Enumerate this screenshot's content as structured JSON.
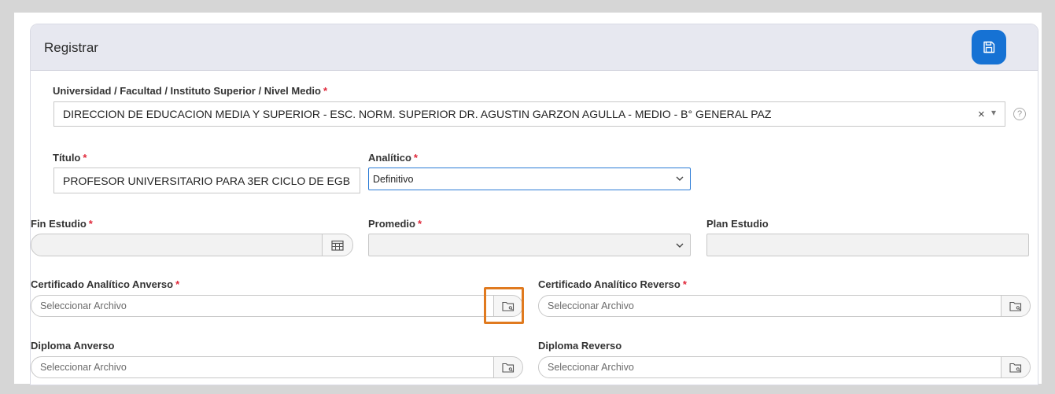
{
  "header": {
    "title": "Registrar",
    "save_icon": "save-icon"
  },
  "universidad": {
    "label": "Universidad / Facultad / Instituto Superior / Nivel Medio",
    "required": "*",
    "value": "DIRECCION DE EDUCACION MEDIA Y SUPERIOR - ESC. NORM. SUPERIOR DR. AGUSTIN GARZON AGULLA - MEDIO - B° GENERAL PAZ",
    "clear": "×",
    "arrow": "▾",
    "help": "?"
  },
  "titulo": {
    "label": "Título",
    "required": "*",
    "value": "PROFESOR UNIVERSITARIO PARA 3ER CICLO DE EGB"
  },
  "analitico": {
    "label": "Analítico",
    "required": "*",
    "value": "Definitivo"
  },
  "fin_estudio": {
    "label": "Fin Estudio",
    "required": "*",
    "value": ""
  },
  "promedio": {
    "label": "Promedio",
    "required": "*",
    "value": ""
  },
  "plan_estudio": {
    "label": "Plan Estudio",
    "value": ""
  },
  "cert_anverso": {
    "label": "Certificado Analítico Anverso",
    "required": "*",
    "placeholder": "Seleccionar Archivo"
  },
  "cert_reverso": {
    "label": "Certificado Analítico Reverso",
    "required": "*",
    "placeholder": "Seleccionar Archivo"
  },
  "diploma_anverso": {
    "label": "Diploma Anverso",
    "placeholder": "Seleccionar Archivo"
  },
  "diploma_reverso": {
    "label": "Diploma Reverso",
    "placeholder": "Seleccionar Archivo"
  },
  "colors": {
    "primary": "#1672d4",
    "required": "#e0283a",
    "highlight": "#e07a1f",
    "focus": "#2b7bd6"
  }
}
